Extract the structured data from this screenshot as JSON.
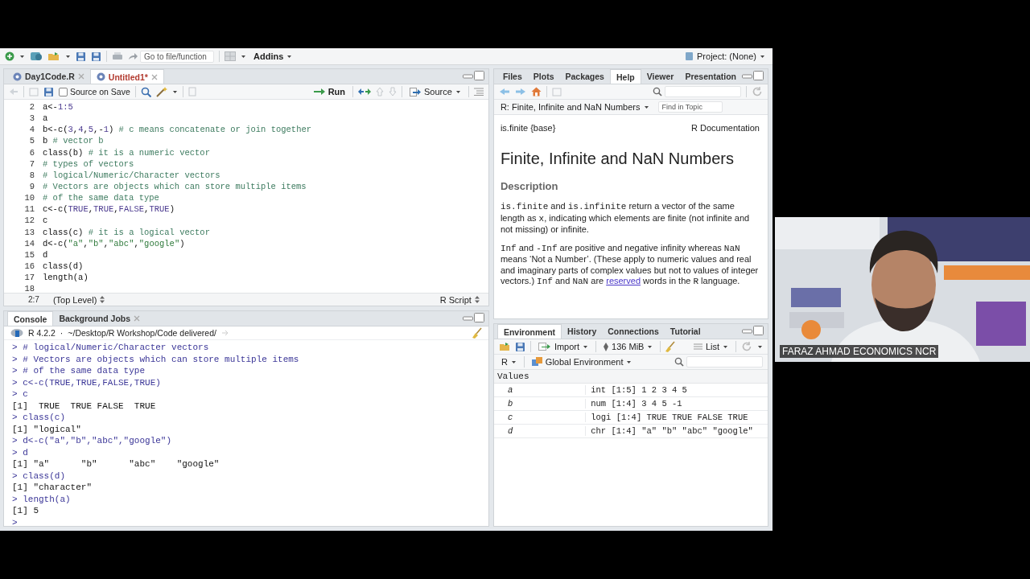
{
  "main_toolbar": {
    "go_to_placeholder": "Go to file/function",
    "addins": "Addins",
    "project": "Project: (None)"
  },
  "source_pane": {
    "tabs": [
      {
        "label": "Day1Code.R",
        "selected": false,
        "unsaved": false
      },
      {
        "label": "Untitled1*",
        "selected": true,
        "unsaved": true
      }
    ],
    "source_on_save": {
      "label": "Source on Save",
      "checked": false
    },
    "run": "Run",
    "source": "Source",
    "lines": [
      {
        "number": "2",
        "segments": [
          {
            "kind": "plain",
            "text": "a<-"
          },
          {
            "kind": "constant",
            "text": "1:5"
          }
        ]
      },
      {
        "number": "3",
        "segments": [
          {
            "kind": "plain",
            "text": "a"
          }
        ]
      },
      {
        "number": "4",
        "segments": [
          {
            "kind": "plain",
            "text": "b<-c("
          },
          {
            "kind": "constant",
            "text": "3"
          },
          {
            "kind": "plain",
            "text": ","
          },
          {
            "kind": "constant",
            "text": "4"
          },
          {
            "kind": "plain",
            "text": ","
          },
          {
            "kind": "constant",
            "text": "5"
          },
          {
            "kind": "plain",
            "text": ",-"
          },
          {
            "kind": "constant",
            "text": "1"
          },
          {
            "kind": "plain",
            "text": ") "
          },
          {
            "kind": "comment",
            "text": "# c means concatenate or join together"
          }
        ]
      },
      {
        "number": "5",
        "segments": [
          {
            "kind": "plain",
            "text": "b "
          },
          {
            "kind": "comment",
            "text": "# vector b"
          }
        ]
      },
      {
        "number": "6",
        "segments": [
          {
            "kind": "plain",
            "text": "class(b) "
          },
          {
            "kind": "comment",
            "text": "# it is a numeric vector"
          }
        ]
      },
      {
        "number": "7",
        "segments": [
          {
            "kind": "comment",
            "text": "# types of vectors"
          }
        ]
      },
      {
        "number": "8",
        "segments": [
          {
            "kind": "comment",
            "text": "# logical/Numeric/Character vectors"
          }
        ]
      },
      {
        "number": "9",
        "segments": [
          {
            "kind": "comment",
            "text": "# Vectors are objects which can store multiple items"
          }
        ]
      },
      {
        "number": "10",
        "segments": [
          {
            "kind": "comment",
            "text": "# of the same data type"
          }
        ]
      },
      {
        "number": "11",
        "segments": [
          {
            "kind": "plain",
            "text": "c<-c("
          },
          {
            "kind": "constant",
            "text": "TRUE"
          },
          {
            "kind": "plain",
            "text": ","
          },
          {
            "kind": "constant",
            "text": "TRUE"
          },
          {
            "kind": "plain",
            "text": ","
          },
          {
            "kind": "constant",
            "text": "FALSE"
          },
          {
            "kind": "plain",
            "text": ","
          },
          {
            "kind": "constant",
            "text": "TRUE"
          },
          {
            "kind": "plain",
            "text": ")"
          }
        ]
      },
      {
        "number": "12",
        "segments": [
          {
            "kind": "plain",
            "text": "c"
          }
        ]
      },
      {
        "number": "13",
        "segments": [
          {
            "kind": "plain",
            "text": "class(c) "
          },
          {
            "kind": "comment",
            "text": "# it is a logical vector"
          }
        ]
      },
      {
        "number": "14",
        "segments": [
          {
            "kind": "plain",
            "text": "d<-c("
          },
          {
            "kind": "string",
            "text": "\"a\""
          },
          {
            "kind": "plain",
            "text": ","
          },
          {
            "kind": "string",
            "text": "\"b\""
          },
          {
            "kind": "plain",
            "text": ","
          },
          {
            "kind": "string",
            "text": "\"abc\""
          },
          {
            "kind": "plain",
            "text": ","
          },
          {
            "kind": "string",
            "text": "\"google\""
          },
          {
            "kind": "plain",
            "text": ")"
          }
        ]
      },
      {
        "number": "15",
        "segments": [
          {
            "kind": "plain",
            "text": "d"
          }
        ]
      },
      {
        "number": "16",
        "segments": [
          {
            "kind": "plain",
            "text": "class(d)"
          }
        ]
      },
      {
        "number": "17",
        "segments": [
          {
            "kind": "plain",
            "text": "length(a)"
          }
        ]
      },
      {
        "number": "18"
      }
    ],
    "status": {
      "position": "2:7",
      "scope": "(Top Level)",
      "file_type": "R Script"
    }
  },
  "console_pane": {
    "tabs": [
      {
        "label": "Console",
        "selected": true
      },
      {
        "label": "Background Jobs",
        "selected": false
      }
    ],
    "r_version": "R 4.2.2",
    "path_separator": "·",
    "path": "~/Desktop/R Workshop/Code delivered/",
    "lines": [
      {
        "kind": "input",
        "text": "> # logical/Numeric/Character vectors"
      },
      {
        "kind": "input",
        "text": "> # Vectors are objects which can store multiple items"
      },
      {
        "kind": "input",
        "text": "> # of the same data type"
      },
      {
        "kind": "input",
        "text": "> c<-c(TRUE,TRUE,FALSE,TRUE)"
      },
      {
        "kind": "input",
        "text": "> c"
      },
      {
        "kind": "output",
        "text": "[1]  TRUE  TRUE FALSE  TRUE"
      },
      {
        "kind": "input",
        "text": "> class(c)"
      },
      {
        "kind": "output",
        "text": "[1] \"logical\""
      },
      {
        "kind": "input",
        "text": "> d<-c(\"a\",\"b\",\"abc\",\"google\")"
      },
      {
        "kind": "input",
        "text": "> d"
      },
      {
        "kind": "output",
        "text": "[1] \"a\"      \"b\"      \"abc\"    \"google\""
      },
      {
        "kind": "input",
        "text": "> class(d)"
      },
      {
        "kind": "output",
        "text": "[1] \"character\""
      },
      {
        "kind": "input",
        "text": "> length(a)"
      },
      {
        "kind": "output",
        "text": "[1] 5"
      },
      {
        "kind": "prompt",
        "text": ">"
      }
    ]
  },
  "help_pane": {
    "tabs": [
      {
        "label": "Files",
        "selected": false
      },
      {
        "label": "Plots",
        "selected": false
      },
      {
        "label": "Packages",
        "selected": false
      },
      {
        "label": "Help",
        "selected": true
      },
      {
        "label": "Viewer",
        "selected": false
      },
      {
        "label": "Presentation",
        "selected": false
      }
    ],
    "topic": "R: Finite, Infinite and NaN Numbers",
    "find_placeholder": "Find in Topic",
    "doc": {
      "package": "is.finite {base}",
      "source": "R Documentation",
      "title": "Finite, Infinite and NaN Numbers",
      "section": "Description",
      "paragraphs": [
        [
          {
            "kind": "code",
            "text": "is.finite"
          },
          {
            "kind": "text",
            "text": " and "
          },
          {
            "kind": "code",
            "text": "is.infinite"
          },
          {
            "kind": "text",
            "text": " return a vector of the same length as "
          },
          {
            "kind": "code",
            "text": "x"
          },
          {
            "kind": "text",
            "text": ", indicating which elements are finite (not infinite and not missing) or infinite."
          }
        ],
        [
          {
            "kind": "code",
            "text": "Inf"
          },
          {
            "kind": "text",
            "text": " and "
          },
          {
            "kind": "code",
            "text": "-Inf"
          },
          {
            "kind": "text",
            "text": " are positive and negative infinity whereas "
          },
          {
            "kind": "code",
            "text": "NaN"
          },
          {
            "kind": "text",
            "text": " means ‘Not a Number’. (These apply to numeric values and real and imaginary parts of complex values but not to values of integer vectors.) "
          },
          {
            "kind": "code",
            "text": "Inf"
          },
          {
            "kind": "text",
            "text": " and "
          },
          {
            "kind": "code",
            "text": "NaN"
          },
          {
            "kind": "text",
            "text": " are "
          },
          {
            "kind": "link",
            "text": "reserved"
          },
          {
            "kind": "text",
            "text": " words in the "
          },
          {
            "kind": "code",
            "text": "R"
          },
          {
            "kind": "text",
            "text": " language."
          }
        ]
      ]
    }
  },
  "environment_pane": {
    "tabs": [
      {
        "label": "Environment",
        "selected": true
      },
      {
        "label": "History",
        "selected": false
      },
      {
        "label": "Connections",
        "selected": false
      },
      {
        "label": "Tutorial",
        "selected": false
      }
    ],
    "import": "Import",
    "memory": "136 MiB",
    "view": "List",
    "language": "R",
    "scope": "Global Environment",
    "section": "Values",
    "rows": [
      {
        "name": "a",
        "value": "int [1:5] 1 2 3 4 5"
      },
      {
        "name": "b",
        "value": "num [1:4] 3 4 5 -1"
      },
      {
        "name": "c",
        "value": "logi [1:4] TRUE TRUE FALSE TRUE"
      },
      {
        "name": "d",
        "value": "chr [1:4] \"a\" \"b\" \"abc\" \"google\""
      }
    ]
  },
  "video": {
    "participant": "FARAZ AHMAD ECONOMICS NCR"
  }
}
